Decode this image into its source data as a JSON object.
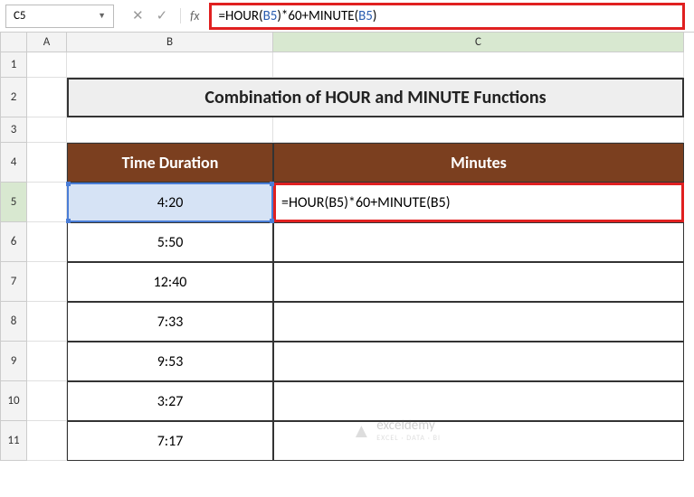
{
  "formula_bar": {
    "cell_ref": "C5",
    "btn_cancel": "✕",
    "btn_accept": "✓",
    "btn_fx": "fx",
    "formula_prefix1": "=HOUR(",
    "formula_ref1": "B5",
    "formula_mid": ")*60+MINUTE(",
    "formula_ref2": "B5",
    "formula_suffix": ")"
  },
  "columns": {
    "A": "A",
    "B": "B",
    "C": "C"
  },
  "rows": [
    "1",
    "2",
    "3",
    "4",
    "5",
    "6",
    "7",
    "8",
    "9",
    "10",
    "11"
  ],
  "title": "Combination of HOUR and MINUTE Functions",
  "headers": {
    "col_b": "Time Duration",
    "col_c": "Minutes"
  },
  "data_b": [
    "4:20",
    "5:50",
    "12:40",
    "7:33",
    "9:53",
    "3:27",
    "7:17"
  ],
  "editing_formula": "=HOUR(B5)*60+MINUTE(B5)",
  "watermark": {
    "brand": "exceldemy",
    "tag": "EXCEL · DATA · BI"
  },
  "chart_data": {
    "type": "table",
    "title": "Combination of HOUR and MINUTE Functions",
    "columns": [
      "Time Duration",
      "Minutes"
    ],
    "rows": [
      {
        "Time Duration": "4:20",
        "Minutes": "=HOUR(B5)*60+MINUTE(B5)"
      },
      {
        "Time Duration": "5:50",
        "Minutes": ""
      },
      {
        "Time Duration": "12:40",
        "Minutes": ""
      },
      {
        "Time Duration": "7:33",
        "Minutes": ""
      },
      {
        "Time Duration": "9:53",
        "Minutes": ""
      },
      {
        "Time Duration": "3:27",
        "Minutes": ""
      },
      {
        "Time Duration": "7:17",
        "Minutes": ""
      }
    ],
    "formula_bar": "=HOUR(B5)*60+MINUTE(B5)",
    "active_cell": "C5"
  }
}
